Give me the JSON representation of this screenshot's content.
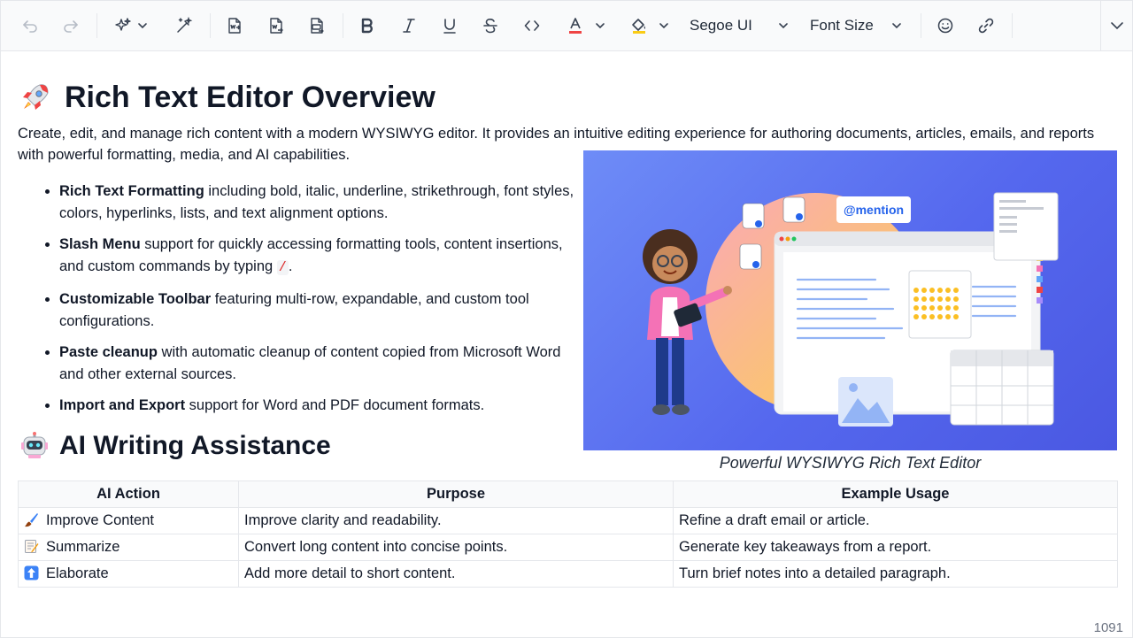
{
  "toolbar": {
    "font_family": "Segoe UI",
    "font_size": "Font Size",
    "items": [
      "undo-icon",
      "redo-icon",
      "ai-assistant-icon",
      "chevron-down-icon",
      "ai-quick-edit-icon",
      "import-word-icon",
      "export-word-icon",
      "export-pdf-icon",
      "bold-icon",
      "italic-icon",
      "underline-icon",
      "strikethrough-icon",
      "inline-code-icon",
      "font-color-icon",
      "background-color-icon",
      "emoji-icon",
      "link-icon",
      "expand-toolbar-icon"
    ],
    "font_color_accent": "#ef4444",
    "background_color_accent": "#facc15"
  },
  "document": {
    "title": "Rich Text Editor Overview",
    "intro": "Create, edit, and manage rich content with a modern WYSIWYG editor. It provides an intuitive editing experience for authoring documents, articles, emails, and reports with powerful formatting, media, and AI capabilities.",
    "features": [
      {
        "title": "Rich Text Formatting",
        "text": " including bold, italic, underline, strikethrough, font styles, colors, hyperlinks, lists, and text alignment options."
      },
      {
        "title": "Slash Menu",
        "text": " support for quickly accessing formatting tools, content insertions, and custom commands by typing ",
        "code": "/",
        "tail": "."
      },
      {
        "title": "Customizable Toolbar",
        "text": " featuring multi-row, expandable, and custom tool configurations."
      },
      {
        "title": "Paste cleanup",
        "text": " with automatic cleanup of content copied from Microsoft Word and other external sources."
      },
      {
        "title": "Import and Export",
        "text": " support for Word and PDF document formats."
      }
    ],
    "image": {
      "mention_label": "@mention",
      "caption": "Powerful WYSIWYG Rich Text Editor"
    },
    "ai_heading": "AI Writing Assistance",
    "ai_table": {
      "headers": [
        "AI Action",
        "Purpose",
        "Example Usage"
      ],
      "rows": [
        {
          "icon": "paintbrush-icon",
          "action": "Improve Content",
          "purpose": "Improve clarity and readability.",
          "example": "Refine a draft email or article."
        },
        {
          "icon": "memo-icon",
          "action": "Summarize",
          "purpose": "Convert long content into concise points.",
          "example": "Generate key takeaways from a report."
        },
        {
          "icon": "up-arrow-icon",
          "action": "Elaborate",
          "purpose": "Add more detail to short content.",
          "example": "Turn brief notes into a detailed paragraph."
        }
      ]
    }
  },
  "status_bar": {
    "word_count": "1091"
  },
  "colors": {
    "hero_background": "#5b6cf0",
    "accent_red": "#dc2626"
  }
}
